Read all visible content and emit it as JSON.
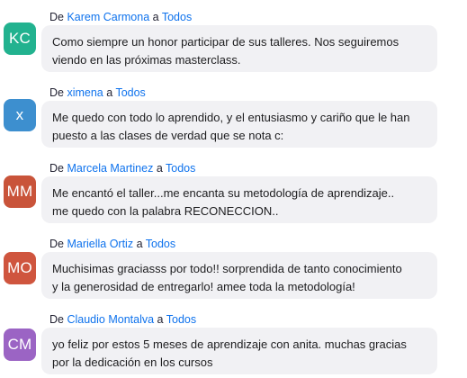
{
  "messages": [
    {
      "initials": "KC",
      "avatar_color": "#22b28f",
      "prefix": "De",
      "sender": "Karem Carmona",
      "connector": "a",
      "recipient": "Todos",
      "lines": [
        "Como siempre un honor participar de sus talleres. Nos seguiremos",
        "viendo en las próximas masterclass."
      ]
    },
    {
      "initials": "x",
      "avatar_color": "#3d8fcf",
      "prefix": "De",
      "sender": "ximena",
      "connector": "a",
      "recipient": "Todos",
      "lines": [
        "Me quedo con todo lo aprendido, y el entusiasmo y cariño que le han",
        "puesto a las clases de verdad que se nota c:"
      ]
    },
    {
      "initials": "MM",
      "avatar_color": "#c9543a",
      "prefix": "De",
      "sender": "Marcela Martinez",
      "connector": "a",
      "recipient": "Todos",
      "lines": [
        "Me encantó el taller...me encanta su metodología de aprendizaje..",
        "me quedo con la palabra RECONECCION.."
      ]
    },
    {
      "initials": "MO",
      "avatar_color": "#cf553e",
      "prefix": "De",
      "sender": "Mariella Ortiz",
      "connector": "a",
      "recipient": "Todos",
      "lines": [
        "Muchisimas graciasss por todo!! sorprendida de tanto conocimiento",
        "y la generosidad de entregarlo! amee toda la metodología!"
      ]
    },
    {
      "initials": "CM",
      "avatar_color": "#9b64c4",
      "prefix": "De",
      "sender": "Claudio Montalva",
      "connector": "a",
      "recipient": "Todos",
      "lines": [
        "yo feliz por estos 5 meses de aprendizaje con anita. muchas gracias",
        "por la dedicación en los cursos"
      ]
    }
  ]
}
